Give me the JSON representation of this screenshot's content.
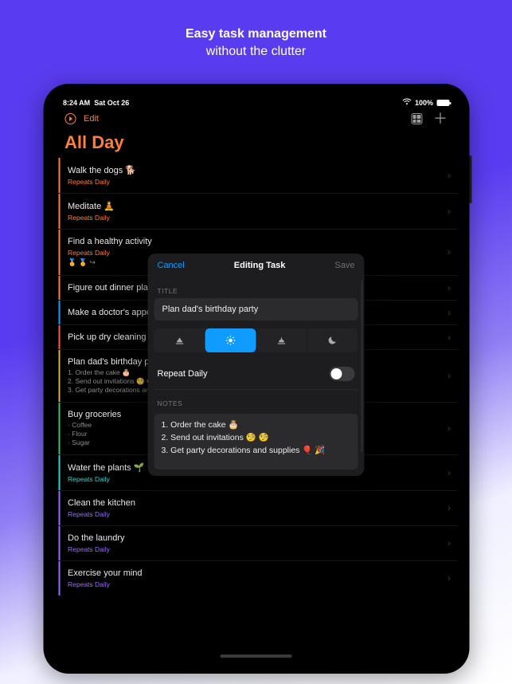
{
  "marketing": {
    "headline": "Easy task management",
    "subline": "without the clutter"
  },
  "statusbar": {
    "time": "8:24 AM",
    "date": "Sat Oct 26",
    "battery_pct": "100%"
  },
  "navbar": {
    "edit_label": "Edit"
  },
  "page_title": "All Day",
  "colors": {
    "accent_orange": "#ff7e39",
    "accent_blue": "#0f9bff",
    "accent_purple": "#9a6bff",
    "accent_green": "#3fbf6b",
    "accent_red": "#ff5a4d",
    "accent_teal": "#2fd1c8",
    "accent_gold": "#d8b14a"
  },
  "tasks": [
    {
      "title": "Walk the dogs 🐕",
      "repeats": "Repeats Daily",
      "stripe": "#ff7e39",
      "repeats_color": "#ff7e39"
    },
    {
      "title": "Meditate 🧘",
      "repeats": "Repeats Daily",
      "stripe": "#ff7e39",
      "repeats_color": "#ff7e39"
    },
    {
      "title": "Find a healthy activity",
      "repeats": "Repeats Daily",
      "stripe": "#ff7e39",
      "repeats_color": "#ff7e39",
      "badges": "🏅 🏅 ↪"
    },
    {
      "title": "Figure out dinner plans",
      "stripe": "#ff7e39"
    },
    {
      "title": "Make a doctor's appointment",
      "stripe": "#0f9bff"
    },
    {
      "title": "Pick up dry cleaning",
      "stripe": "#ff5a4d"
    },
    {
      "title": "Plan dad's birthday party",
      "stripe": "#d8b14a",
      "sub": "1. Order the cake 🎂\n2. Send out invitations 🧐 🧐\n3. Get party decorations and supplies"
    },
    {
      "title": "Buy groceries",
      "stripe": "#3fbf6b",
      "sub": "· Coffee\n· Flour\n· Sugar"
    },
    {
      "title": "Water the plants 🌱",
      "repeats": "Repeats Daily",
      "stripe": "#2fd1c8",
      "repeats_color": "#2fd1c8"
    },
    {
      "title": "Clean the kitchen",
      "repeats": "Repeats Daily",
      "stripe": "#9a6bff",
      "repeats_color": "#9a6bff"
    },
    {
      "title": "Do the laundry",
      "repeats": "Repeats Daily",
      "stripe": "#9a6bff",
      "repeats_color": "#9a6bff"
    },
    {
      "title": "Exercise your mind",
      "repeats": "Repeats Daily",
      "stripe": "#9a6bff",
      "repeats_color": "#9a6bff"
    }
  ],
  "modal": {
    "cancel_label": "Cancel",
    "title": "Editing Task",
    "save_label": "Save",
    "section_title_label": "TITLE",
    "title_value": "Plan dad's birthday party",
    "segments": {
      "options": [
        "sunrise-icon",
        "sun-icon",
        "sunset-icon",
        "moon-icon"
      ],
      "selected_index": 1
    },
    "repeat_label": "Repeat Daily",
    "repeat_on": false,
    "section_notes_label": "NOTES",
    "notes_value": "1. Order the cake 🎂\n2. Send out invitations 🧐 🧐\n3. Get party decorations and supplies 🎈 🎉"
  }
}
